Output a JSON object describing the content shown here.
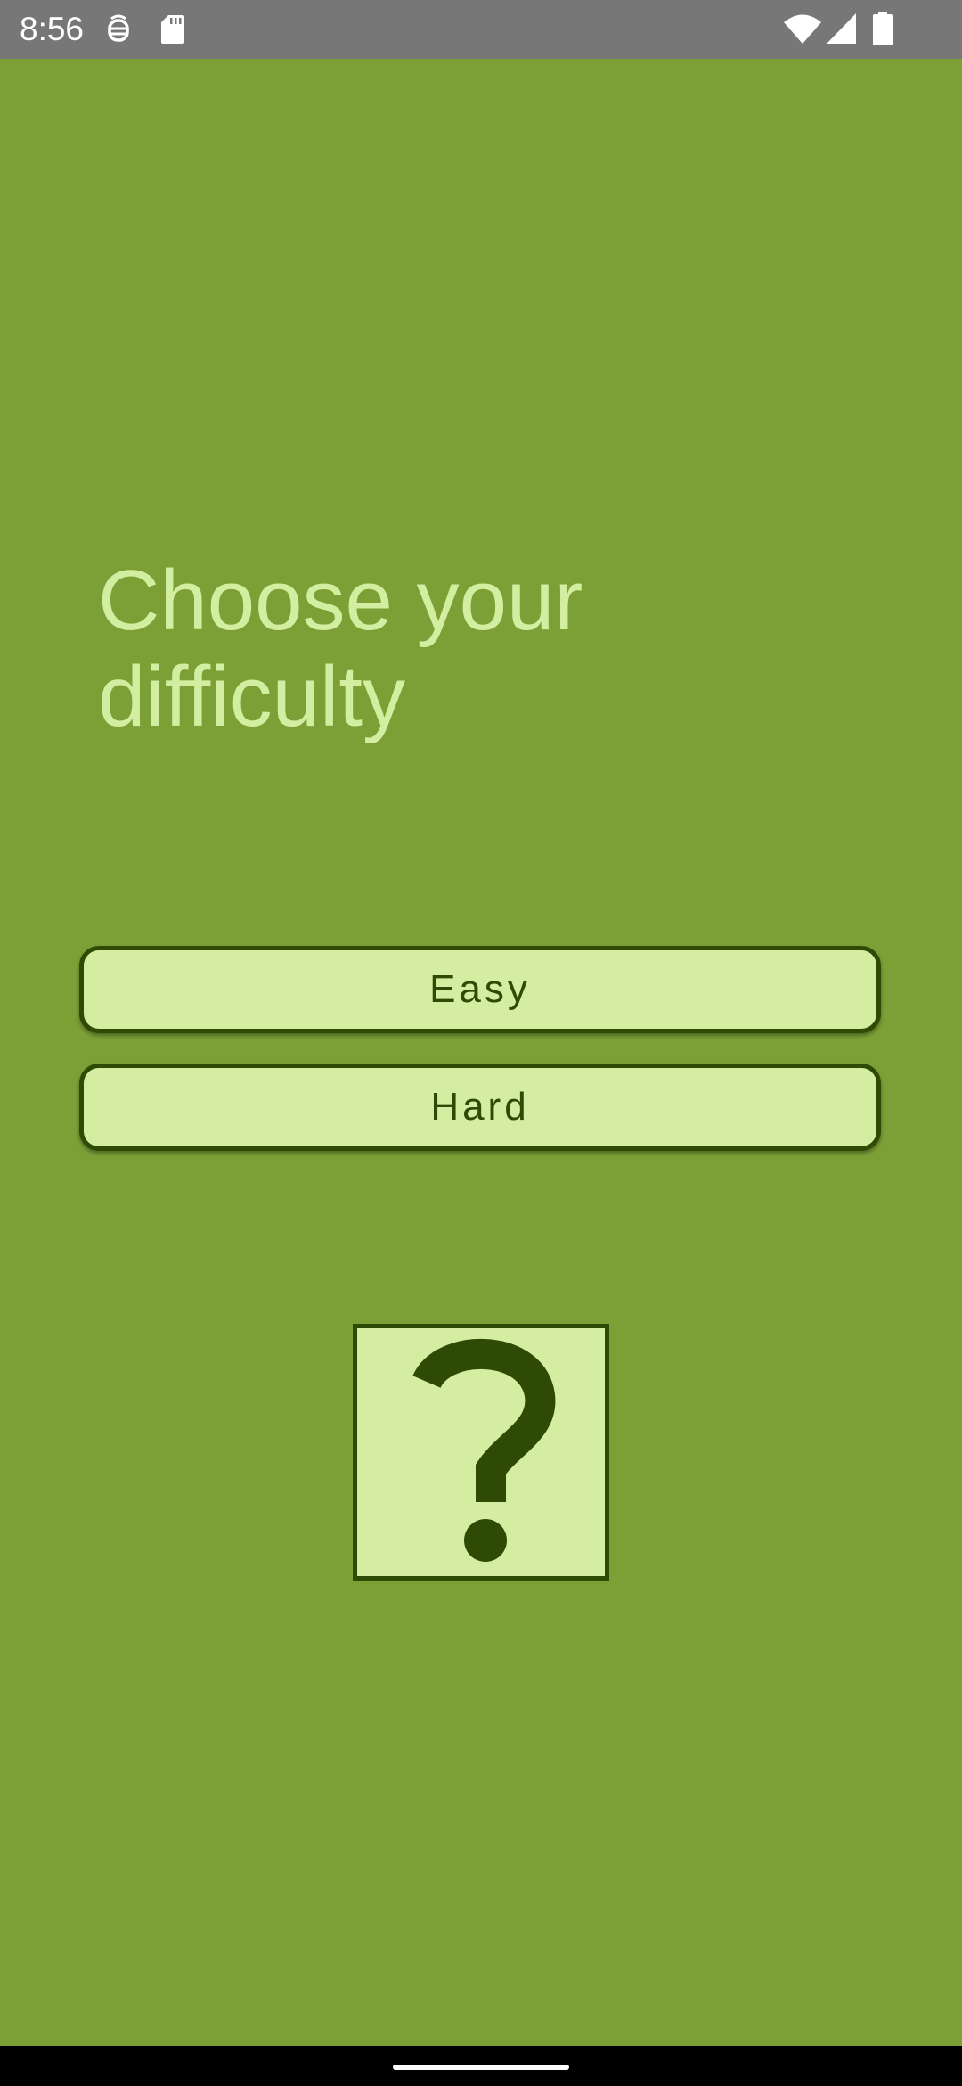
{
  "status_bar": {
    "time": "8:56",
    "icons": [
      "debug-icon",
      "sd-card-icon",
      "wifi-icon",
      "signal-icon",
      "battery-icon"
    ]
  },
  "main": {
    "title": "Choose your difficulty",
    "buttons": {
      "easy_label": "Easy",
      "hard_label": "Hard"
    },
    "image_icon": "question-mark-icon"
  },
  "colors": {
    "background": "#7ca036",
    "accent_light": "#d4eda0",
    "accent_dark": "#2f4a05",
    "title_text": "#d3eea0",
    "status_bar": "#777777"
  }
}
